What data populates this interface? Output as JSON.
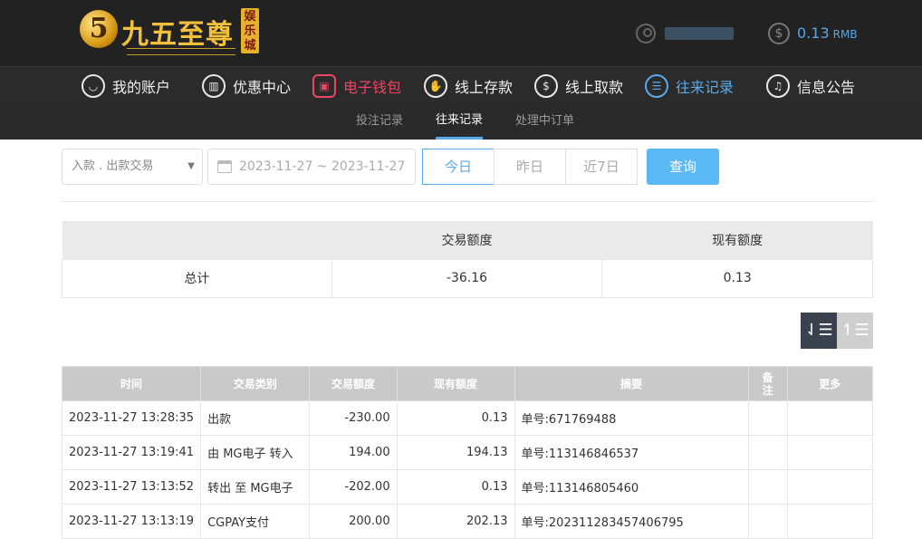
{
  "header": {
    "logo_mark": "5",
    "logo_text": "九五至尊",
    "logo_badge": "娱乐城",
    "balance_value": "0.13",
    "balance_unit": "RMB"
  },
  "nav": {
    "items": [
      {
        "label": "我的账户",
        "icon": "user-icon"
      },
      {
        "label": "优惠中心",
        "icon": "gift-icon"
      },
      {
        "label": "电子钱包",
        "icon": "wallet-icon"
      },
      {
        "label": "线上存款",
        "icon": "deposit-icon"
      },
      {
        "label": "线上取款",
        "icon": "withdraw-icon"
      },
      {
        "label": "往来记录",
        "icon": "records-icon"
      },
      {
        "label": "信息公告",
        "icon": "bell-icon"
      }
    ]
  },
  "subnav": {
    "items": [
      "投注记录",
      "往来记录",
      "处理中订单"
    ],
    "active": "往来记录"
  },
  "filters": {
    "type_select": "入款 . 出款交易",
    "date_range": "2023-11-27 ~ 2023-11-27",
    "quick": [
      "今日",
      "昨日",
      "近7日"
    ],
    "search_label": "查询"
  },
  "summary": {
    "headers": [
      "",
      "交易额度",
      "现有额度"
    ],
    "row": [
      "总计",
      "-36.16",
      "0.13"
    ]
  },
  "records": {
    "headers": [
      "时间",
      "交易类别",
      "交易额度",
      "现有额度",
      "摘要",
      "备注",
      "更多"
    ],
    "rows": [
      [
        "2023-11-27 13:28:35",
        "出款",
        "-230.00",
        "0.13",
        "单号:671769488",
        "",
        ""
      ],
      [
        "2023-11-27 13:19:41",
        "由 MG电子 转入",
        "194.00",
        "194.13",
        "单号:113146846537",
        "",
        ""
      ],
      [
        "2023-11-27 13:13:52",
        "转出 至 MG电子",
        "-202.00",
        "0.13",
        "单号:113146805460",
        "",
        ""
      ],
      [
        "2023-11-27 13:13:19",
        "CGPAY支付",
        "200.00",
        "202.13",
        "单号:202311283457406795",
        "",
        ""
      ]
    ]
  },
  "colors": {
    "accent_blue": "#5aa9ea",
    "accent_red": "#ee4466",
    "header_bg": "#222222",
    "gold": "#f3c03c"
  }
}
